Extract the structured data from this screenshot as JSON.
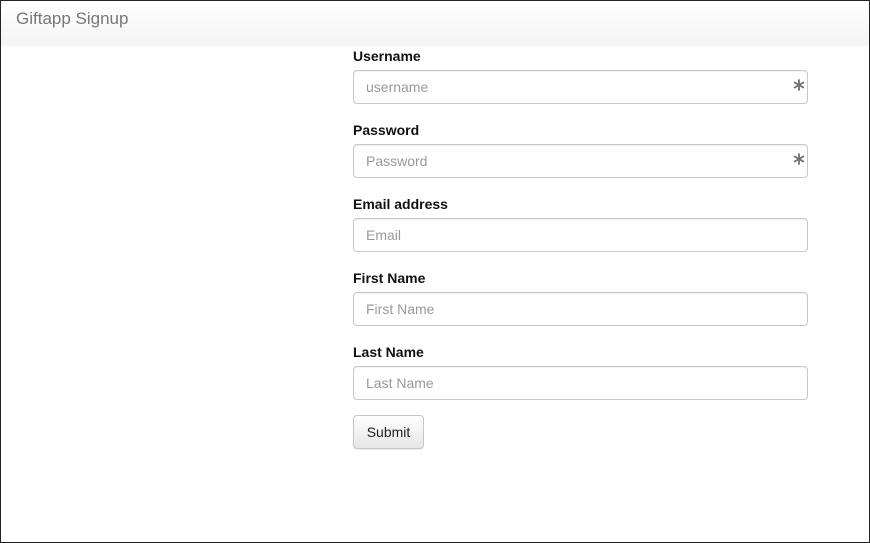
{
  "navbar": {
    "brand": "Giftapp Signup"
  },
  "form": {
    "fields": [
      {
        "label": "Username",
        "placeholder": "username",
        "value": "",
        "required": true
      },
      {
        "label": "Password",
        "placeholder": "Password",
        "value": "",
        "required": true
      },
      {
        "label": "Email address",
        "placeholder": "Email",
        "value": "",
        "required": false
      },
      {
        "label": "First Name",
        "placeholder": "First Name",
        "value": "",
        "required": false
      },
      {
        "label": "Last Name",
        "placeholder": "Last Name",
        "value": "",
        "required": false
      }
    ],
    "submit_label": "Submit"
  },
  "icons": {
    "required": "asterisk-icon"
  },
  "colors": {
    "brand_text": "#777777",
    "input_border": "#c8c8c8",
    "placeholder": "#999999",
    "label_text": "#111111"
  }
}
